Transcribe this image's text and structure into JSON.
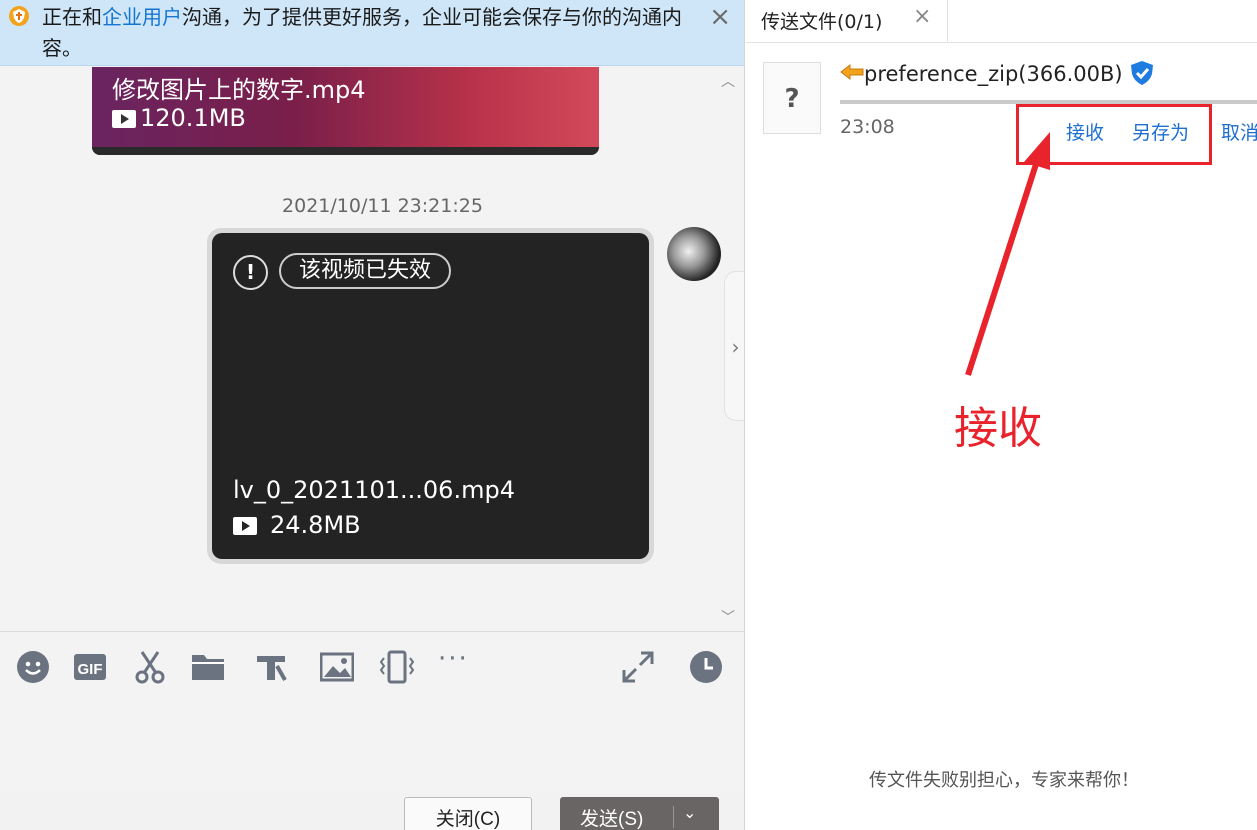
{
  "notice": {
    "prefix": "正在和",
    "link": "企业用户",
    "suffix": "沟通，为了提供更好服务，企业可能会保存与你的沟通内容。",
    "close_symbol": "×"
  },
  "chat": {
    "prev_video": {
      "name": "修改图片上的数字.mp4",
      "size": "120.1MB"
    },
    "timestamp": "2021/10/11 23:21:25",
    "video": {
      "status": "该视频已失效",
      "warn_symbol": "!",
      "name": "lv_0_2021101...06.mp4",
      "size": "24.8MB"
    },
    "side_toggle_symbol": "›",
    "scroll_up": "︿",
    "scroll_down": "﹀"
  },
  "toolbar": {
    "icons": [
      "emoji-icon",
      "gif-icon",
      "scissors-icon",
      "folder-icon",
      "rich-text-icon",
      "image-icon",
      "shake-icon",
      "more-icon",
      "expand-icon",
      "history-icon"
    ],
    "gif_label": "GIF",
    "more_symbol": "···"
  },
  "buttons": {
    "close": "关闭(C)",
    "send": "发送(S)",
    "send_dropdown": "⌄"
  },
  "transfer": {
    "tab_label": "传送文件(0/1)",
    "tab_close": "×",
    "file_icon_symbol": "?",
    "file_name": "preference_zip(366.00B)",
    "time": "23:08",
    "actions": {
      "receive": "接收",
      "save_as": "另存为",
      "cancel": "取消"
    },
    "help": "传文件失败别担心，专家来帮你！"
  },
  "annotation": {
    "label": "接收",
    "color": "#e8232b"
  },
  "colors": {
    "link": "#1576d2",
    "action": "#1e6fd0",
    "notice_bg": "#cfe6f8",
    "send_bg": "#6a6565"
  }
}
